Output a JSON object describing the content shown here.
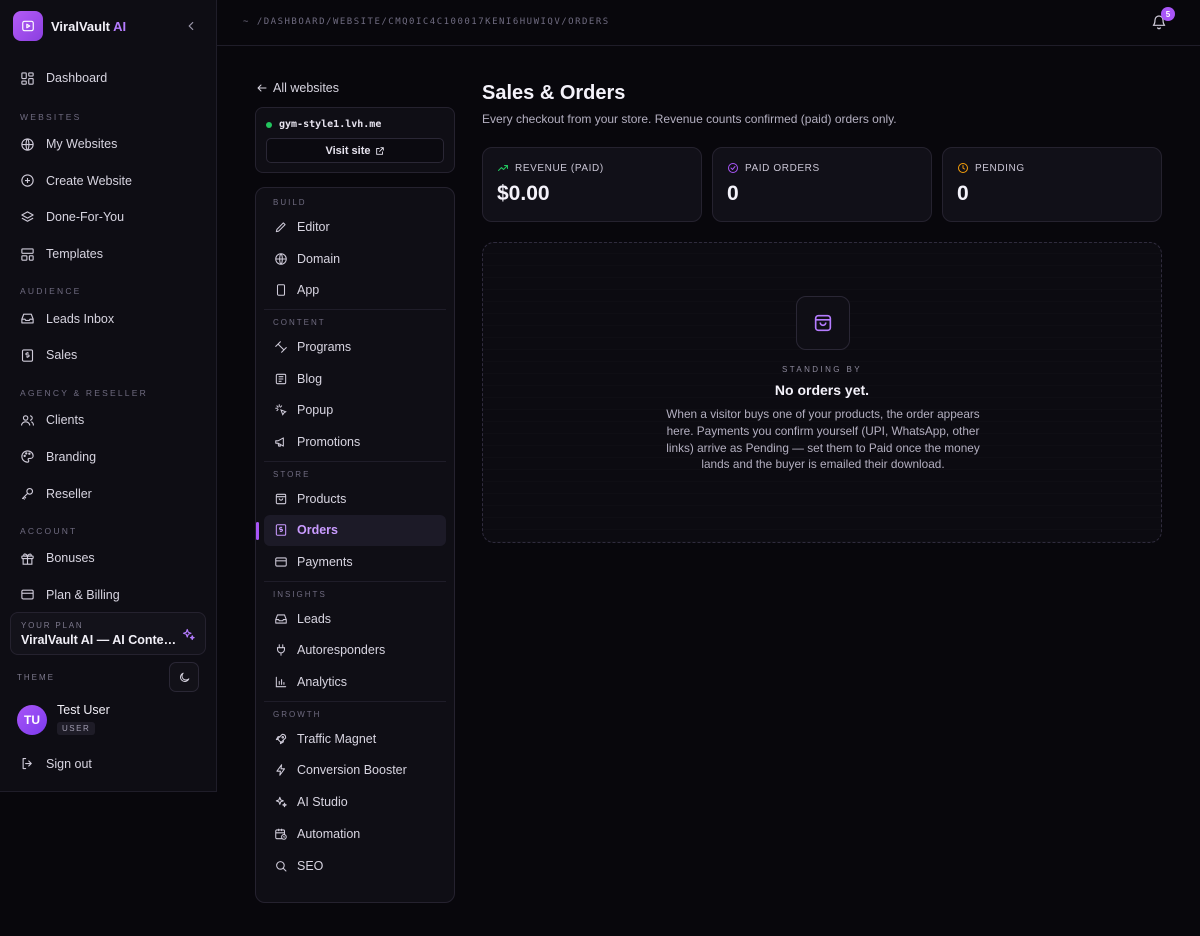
{
  "brand": {
    "name": "ViralVault",
    "accent": "AI"
  },
  "sidebar": {
    "dashboard": "Dashboard",
    "sections": {
      "websites": "WEBSITES",
      "audience": "AUDIENCE",
      "agency": "AGENCY & RESELLER",
      "account": "ACCOUNT"
    },
    "items": {
      "my_websites": "My Websites",
      "create_website": "Create Website",
      "done_for_you": "Done-For-You",
      "templates": "Templates",
      "leads_inbox": "Leads Inbox",
      "sales": "Sales",
      "clients": "Clients",
      "branding": "Branding",
      "reseller": "Reseller",
      "bonuses": "Bonuses",
      "plan_billing": "Plan & Billing"
    },
    "plan": {
      "label": "YOUR PLAN",
      "name": "ViralVault AI — AI Content Suite"
    },
    "theme_label": "THEME",
    "user": {
      "initials": "TU",
      "name": "Test User",
      "role": "USER"
    },
    "sign_out": "Sign out"
  },
  "topbar": {
    "breadcrumb": "~ /DASHBOARD/WEBSITE/CMQ0IC4C100017KENI6HUWIQV/ORDERS",
    "notifications": "5"
  },
  "site": {
    "back": "All websites",
    "domain": "gym-style1.lvh.me",
    "visit": "Visit site"
  },
  "menu": {
    "build": "BUILD",
    "editor": "Editor",
    "domain": "Domain",
    "app": "App",
    "content": "CONTENT",
    "programs": "Programs",
    "blog": "Blog",
    "popup": "Popup",
    "promotions": "Promotions",
    "store": "STORE",
    "products": "Products",
    "orders": "Orders",
    "payments": "Payments",
    "insights": "INSIGHTS",
    "leads": "Leads",
    "autoresponders": "Autoresponders",
    "analytics": "Analytics",
    "growth": "GROWTH",
    "traffic_magnet": "Traffic Magnet",
    "conversion_booster": "Conversion Booster",
    "ai_studio": "AI Studio",
    "automation": "Automation",
    "seo": "SEO"
  },
  "main": {
    "title": "Sales & Orders",
    "subtitle": "Every checkout from your store. Revenue counts confirmed (paid) orders only.",
    "stats": [
      {
        "label": "REVENUE (PAID)",
        "value": "$0.00",
        "icon": "trending-up-icon",
        "color": "#22c55e"
      },
      {
        "label": "PAID ORDERS",
        "value": "0",
        "icon": "check-circle-icon",
        "color": "#a855f7"
      },
      {
        "label": "PENDING",
        "value": "0",
        "icon": "clock-icon",
        "color": "#f59e0b"
      }
    ],
    "empty": {
      "kicker": "STANDING BY",
      "title": "No orders yet.",
      "text": "When a visitor buys one of your products, the order appears here. Payments you confirm yourself (UPI, WhatsApp, other links) arrive as Pending — set them to Paid once the money lands and the buyer is emailed their download."
    }
  },
  "colors": {
    "accent": "#a855f7",
    "background": "#08070c",
    "panel": "#0f0e15"
  }
}
